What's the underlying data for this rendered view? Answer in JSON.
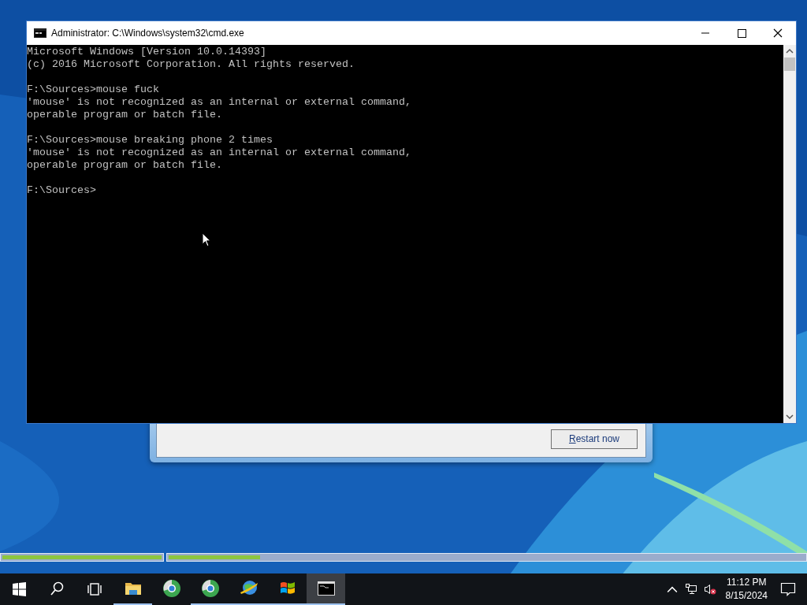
{
  "background_dialog": {
    "button": "Restart now"
  },
  "console_window": {
    "title": "Administrator: C:\\Windows\\system32\\cmd.exe",
    "blocks": [
      [
        "Microsoft Windows [Version 10.0.14393]",
        "(c) 2016 Microsoft Corporation. All rights reserved."
      ],
      [
        "F:\\Sources>mouse fuck",
        "'mouse' is not recognized as an internal or external command,",
        "operable program or batch file."
      ],
      [
        "F:\\Sources>mouse breaking phone 2 times",
        "'mouse' is not recognized as an internal or external command,",
        "operable program or batch file."
      ],
      [
        "F:\\Sources>"
      ]
    ]
  },
  "progress_bars": [
    {
      "level": 1
    },
    {
      "level": 0.144
    }
  ],
  "taskbar": {
    "apps": [
      {
        "kind": "explorer",
        "running": true,
        "selected": false
      },
      {
        "kind": "browser",
        "running": false,
        "selected": false
      },
      {
        "kind": "browser",
        "running": true,
        "selected": false
      },
      {
        "kind": "globe",
        "running": true,
        "selected": false
      },
      {
        "kind": "flag",
        "running": true,
        "selected": false
      },
      {
        "kind": "console",
        "running": true,
        "selected": true
      }
    ],
    "tray": {
      "volume_muted": true,
      "time": "11:12 PM",
      "date": "8/15/2024"
    }
  }
}
